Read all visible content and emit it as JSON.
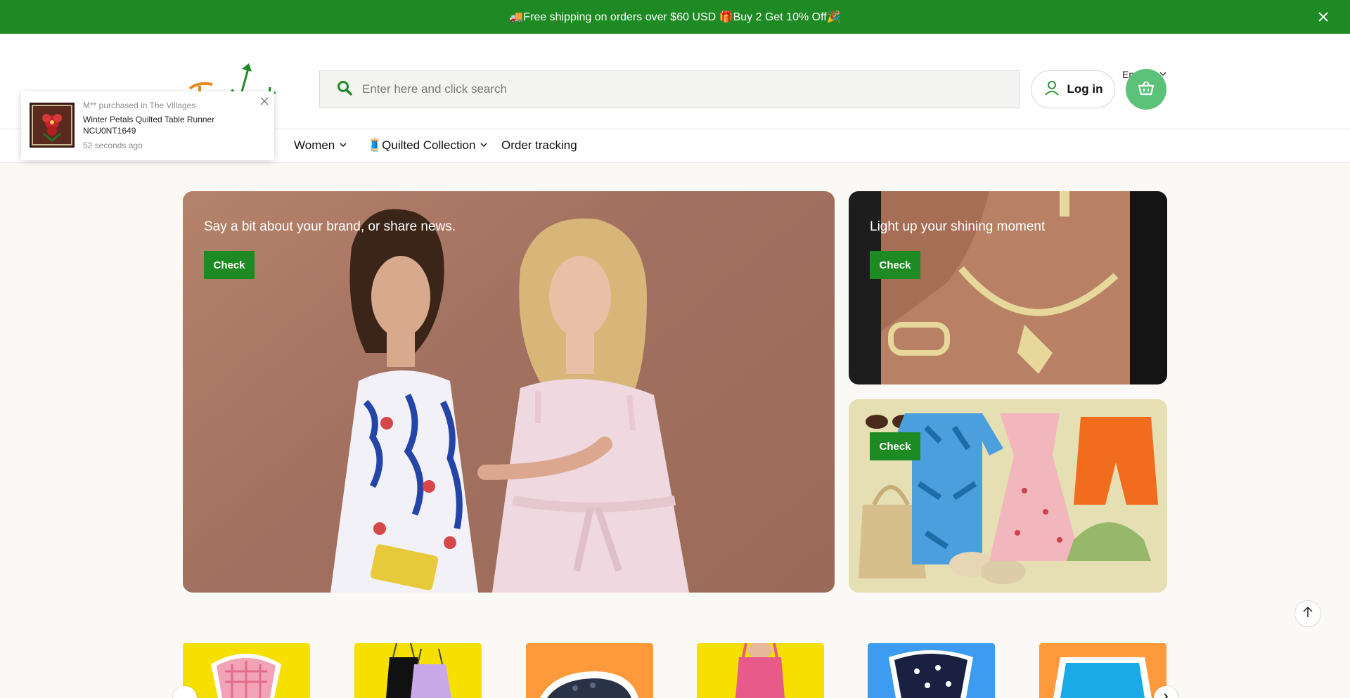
{
  "announcement": {
    "text": "🚚Free shipping on orders over $60 USD 🎁Buy 2 Get 10% Off🎉",
    "close_icon": "close-icon"
  },
  "header": {
    "language": "English",
    "search_placeholder": "Enter here and click search",
    "login_label": "Log in",
    "cart_icon": "basket-icon",
    "brand_color": "#1e8a24",
    "cart_color": "#5cc27a"
  },
  "nav": {
    "items": [
      {
        "label": "Women",
        "has_dropdown": true
      },
      {
        "label": "🧵Quilted Collection",
        "has_dropdown": true
      },
      {
        "label": "Order tracking",
        "has_dropdown": false
      }
    ]
  },
  "popup": {
    "purchased_line": "M** purchased in The Villages",
    "product": "Winter Petals Quilted Table Runner NCU0NT1649",
    "time": "52 seconds ago"
  },
  "hero": {
    "main": {
      "text": "Say a bit about your brand, or share news.",
      "button": "Check"
    },
    "side1": {
      "text": "Light up your shining moment",
      "button": "Check"
    },
    "side2": {
      "button": "Check"
    }
  },
  "categories": [
    {
      "name": "pink-gingham-top",
      "bg": "#f5e000"
    },
    {
      "name": "cami-tops",
      "bg": "#f5e000"
    },
    {
      "name": "clogs",
      "bg": "#ff9a3c"
    },
    {
      "name": "pink-swimsuit",
      "bg": "#f5e000"
    },
    {
      "name": "floral-top",
      "bg": "#3e9cf0"
    },
    {
      "name": "blue-shorts",
      "bg": "#ff9a3c"
    }
  ]
}
